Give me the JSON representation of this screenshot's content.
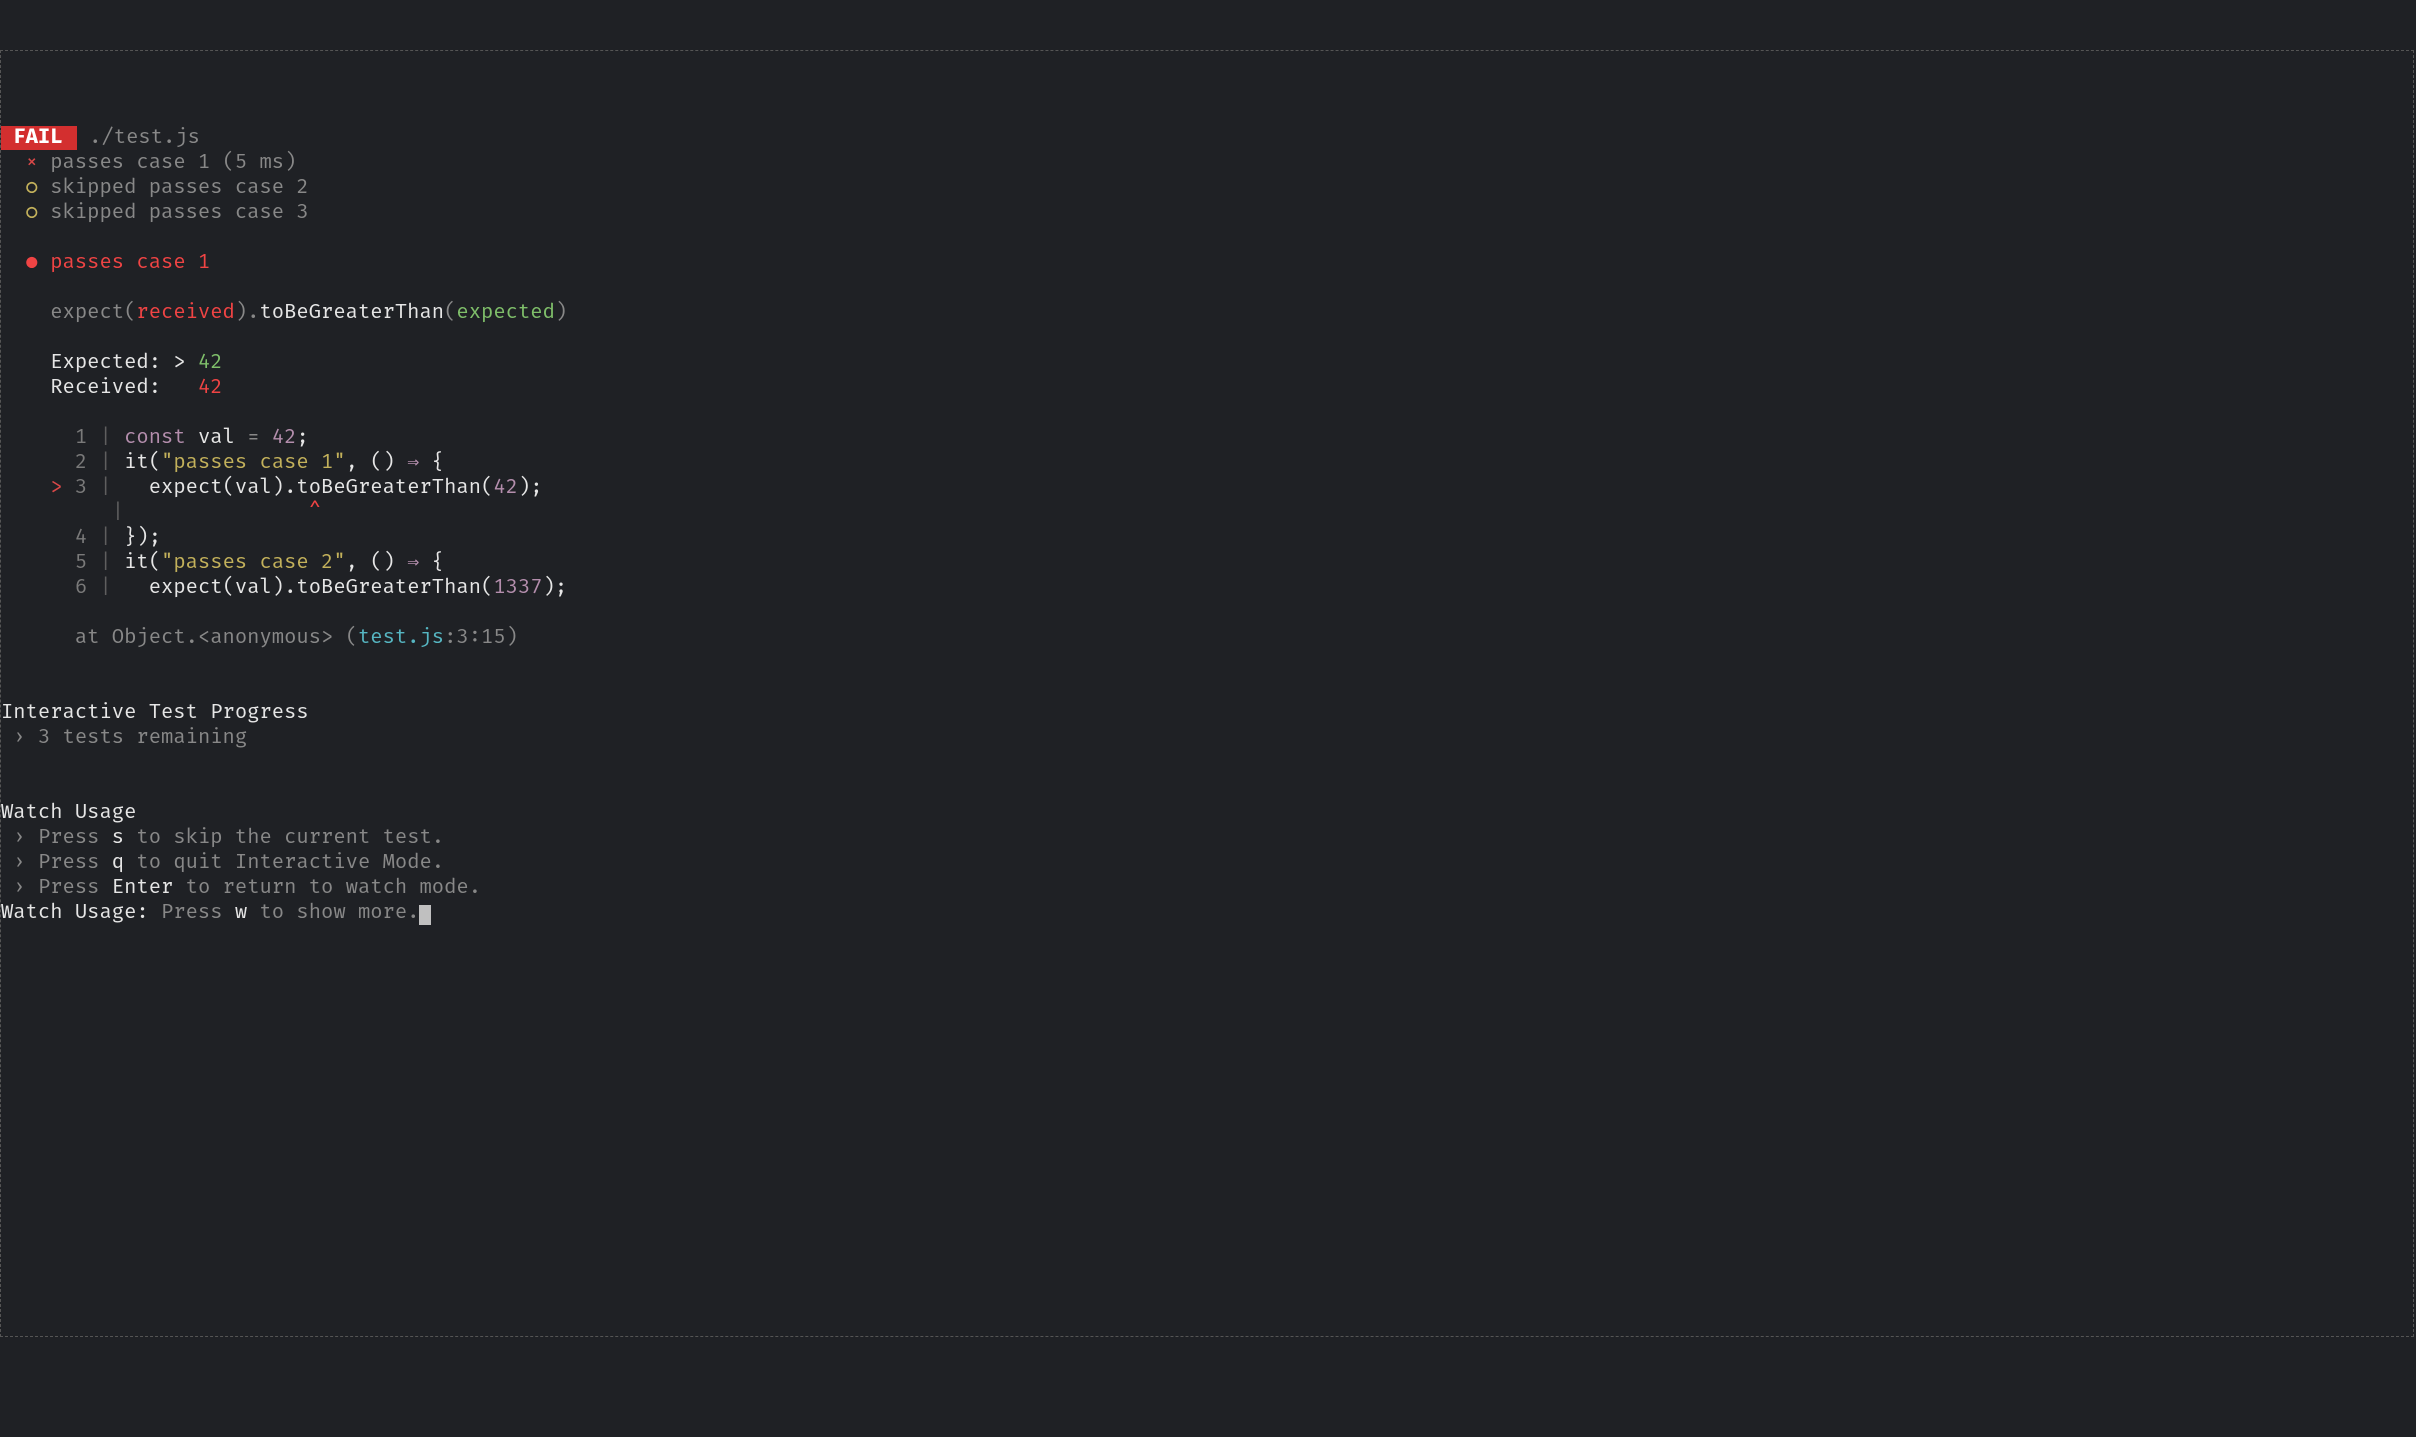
{
  "header": {
    "fail_badge": " FAIL ",
    "file": " ./test.js"
  },
  "results": [
    {
      "mark": "  × ",
      "mark_class": "red",
      "text": "passes case 1 ",
      "text_class": "dim",
      "suffix": "(5 ms)",
      "suffix_class": "dim"
    },
    {
      "mark": "  ○ ",
      "mark_class": "yellow",
      "text": "skipped passes case 2",
      "text_class": "dim",
      "suffix": "",
      "suffix_class": ""
    },
    {
      "mark": "  ○ ",
      "mark_class": "yellow",
      "text": "skipped passes case 3",
      "text_class": "dim",
      "suffix": "",
      "suffix_class": ""
    }
  ],
  "failure": {
    "bullet": "  ● ",
    "title": "passes case 1",
    "matcher_indent": "    ",
    "expect_kw": "expect(",
    "received_kw": "received",
    "close_paren": ").",
    "matcher": "toBeGreaterThan",
    "open_paren2": "(",
    "expected_kw": "expected",
    "close_paren2": ")",
    "expected_label": "    Expected: > ",
    "expected_val": "42",
    "received_label": "    Received:   ",
    "received_val": "42"
  },
  "code": {
    "lines": [
      {
        "prefix": "      ",
        "num": "1",
        "pipe": " | ",
        "tokens": [
          {
            "t": "const ",
            "c": "purple"
          },
          {
            "t": "val ",
            "c": "white"
          },
          {
            "t": "=",
            "c": "dim"
          },
          {
            "t": " 42",
            "c": "purple"
          },
          {
            "t": ";",
            "c": "white"
          }
        ]
      },
      {
        "prefix": "      ",
        "num": "2",
        "pipe": " | ",
        "tokens": [
          {
            "t": "it",
            "c": "white"
          },
          {
            "t": "(",
            "c": "white"
          },
          {
            "t": "\"passes case 1\"",
            "c": "yellow"
          },
          {
            "t": ", () ",
            "c": "white"
          },
          {
            "t": "⇒",
            "c": "purple"
          },
          {
            "t": " {",
            "c": "white"
          }
        ]
      },
      {
        "prefix": "    > ",
        "prefix_class": "red",
        "num": "3",
        "pipe": " | ",
        "tokens": [
          {
            "t": "  expect(val).",
            "c": "white"
          },
          {
            "t": "toBeGreaterThan",
            "c": "white"
          },
          {
            "t": "(",
            "c": "white"
          },
          {
            "t": "42",
            "c": "purple"
          },
          {
            "t": ");",
            "c": "white"
          }
        ]
      },
      {
        "prefix": "       ",
        "num": " ",
        "pipe": " | ",
        "tokens": [
          {
            "t": "              ^",
            "c": "brightred"
          }
        ]
      },
      {
        "prefix": "      ",
        "num": "4",
        "pipe": " | ",
        "tokens": [
          {
            "t": "});",
            "c": "white"
          }
        ]
      },
      {
        "prefix": "      ",
        "num": "5",
        "pipe": " | ",
        "tokens": [
          {
            "t": "it",
            "c": "white"
          },
          {
            "t": "(",
            "c": "white"
          },
          {
            "t": "\"passes case 2\"",
            "c": "yellow"
          },
          {
            "t": ", () ",
            "c": "white"
          },
          {
            "t": "⇒",
            "c": "purple"
          },
          {
            "t": " {",
            "c": "white"
          }
        ]
      },
      {
        "prefix": "      ",
        "num": "6",
        "pipe": " | ",
        "tokens": [
          {
            "t": "  expect(val).",
            "c": "white"
          },
          {
            "t": "toBeGreaterThan",
            "c": "white"
          },
          {
            "t": "(",
            "c": "white"
          },
          {
            "t": "1337",
            "c": "purple"
          },
          {
            "t": ");",
            "c": "white"
          }
        ]
      }
    ],
    "stack_indent": "      ",
    "stack_prefix": "at Object.<anonymous> (",
    "stack_file": "test.js",
    "stack_loc": ":3:15",
    "stack_close": ")"
  },
  "progress": {
    "title": "Interactive Test Progress",
    "line_prefix": " › ",
    "line": "3 tests remaining"
  },
  "watch": {
    "title": "Watch Usage",
    "items": [
      {
        "prefix": " › ",
        "p1": "Press ",
        "key": "s",
        "p2": " to skip the current test."
      },
      {
        "prefix": " › ",
        "p1": "Press ",
        "key": "q",
        "p2": " to quit Interactive Mode."
      },
      {
        "prefix": " › ",
        "p1": "Press ",
        "key": "Enter",
        "p2": " to return to watch mode."
      }
    ],
    "footer_label": "Watch Usage:",
    "footer_p1": " Press ",
    "footer_key": "w",
    "footer_p2": " to show more."
  }
}
